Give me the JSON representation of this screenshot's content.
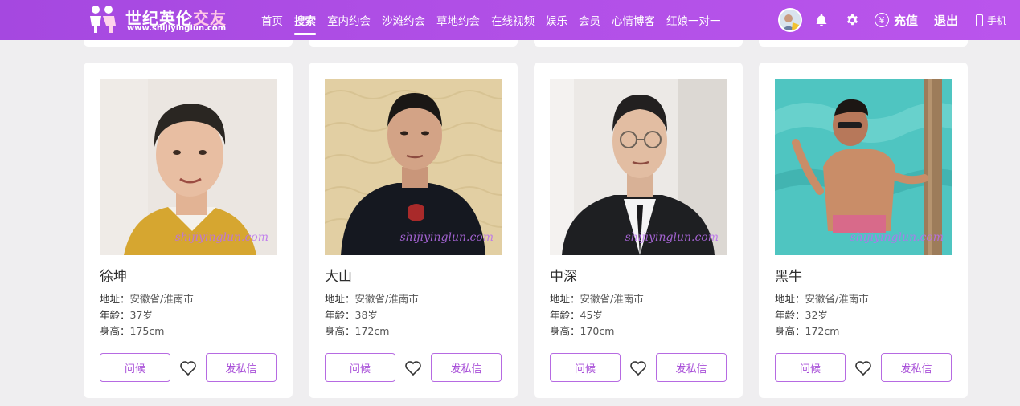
{
  "header": {
    "logo_title_main": "世纪英伦",
    "logo_title_accent": "交友",
    "logo_url": "www.shijiyinglun.com",
    "nav": [
      {
        "label": "首页",
        "active": false
      },
      {
        "label": "搜索",
        "active": true
      },
      {
        "label": "室内约会",
        "active": false
      },
      {
        "label": "沙滩约会",
        "active": false
      },
      {
        "label": "草地约会",
        "active": false
      },
      {
        "label": "在线视频",
        "active": false
      },
      {
        "label": "娱乐",
        "active": false
      },
      {
        "label": "会员",
        "active": false
      },
      {
        "label": "心情博客",
        "active": false
      },
      {
        "label": "红娘一对一",
        "active": false
      }
    ],
    "icons": {
      "notification": "bell-icon",
      "settings": "gear-icon",
      "recharge": "yuan-icon",
      "mobile": "phone-icon"
    },
    "yuan_symbol": "¥",
    "recharge_label": "充值",
    "logout_label": "退出",
    "mobile_label": "手机"
  },
  "profiles": [
    {
      "name": "徐坤",
      "address_label": "地址：",
      "address": "安徽省/淮南市",
      "age_label": "年龄：",
      "age": "37岁",
      "height_label": "身高：",
      "height": "175cm",
      "watermark": "shijiyinglun.com",
      "greet_label": "问候",
      "message_label": "发私信"
    },
    {
      "name": "大山",
      "address_label": "地址：",
      "address": "安徽省/淮南市",
      "age_label": "年龄：",
      "age": "38岁",
      "height_label": "身高：",
      "height": "172cm",
      "watermark": "shijiyinglun.com",
      "greet_label": "问候",
      "message_label": "发私信"
    },
    {
      "name": "中深",
      "address_label": "地址：",
      "address": "安徽省/淮南市",
      "age_label": "年龄：",
      "age": "45岁",
      "height_label": "身高：",
      "height": "170cm",
      "watermark": "shijiyinglun.com",
      "greet_label": "问候",
      "message_label": "发私信"
    },
    {
      "name": "黑牛",
      "address_label": "地址：",
      "address": "安徽省/淮南市",
      "age_label": "年龄：",
      "age": "32岁",
      "height_label": "身高：",
      "height": "172cm",
      "watermark": "shijiyinglun.com",
      "greet_label": "问候",
      "message_label": "发私信"
    }
  ],
  "colors": {
    "header_gradient_start": "#a548e0",
    "header_gradient_end": "#ba55ec",
    "accent": "#a84fd8",
    "page_background": "#efeef0"
  }
}
